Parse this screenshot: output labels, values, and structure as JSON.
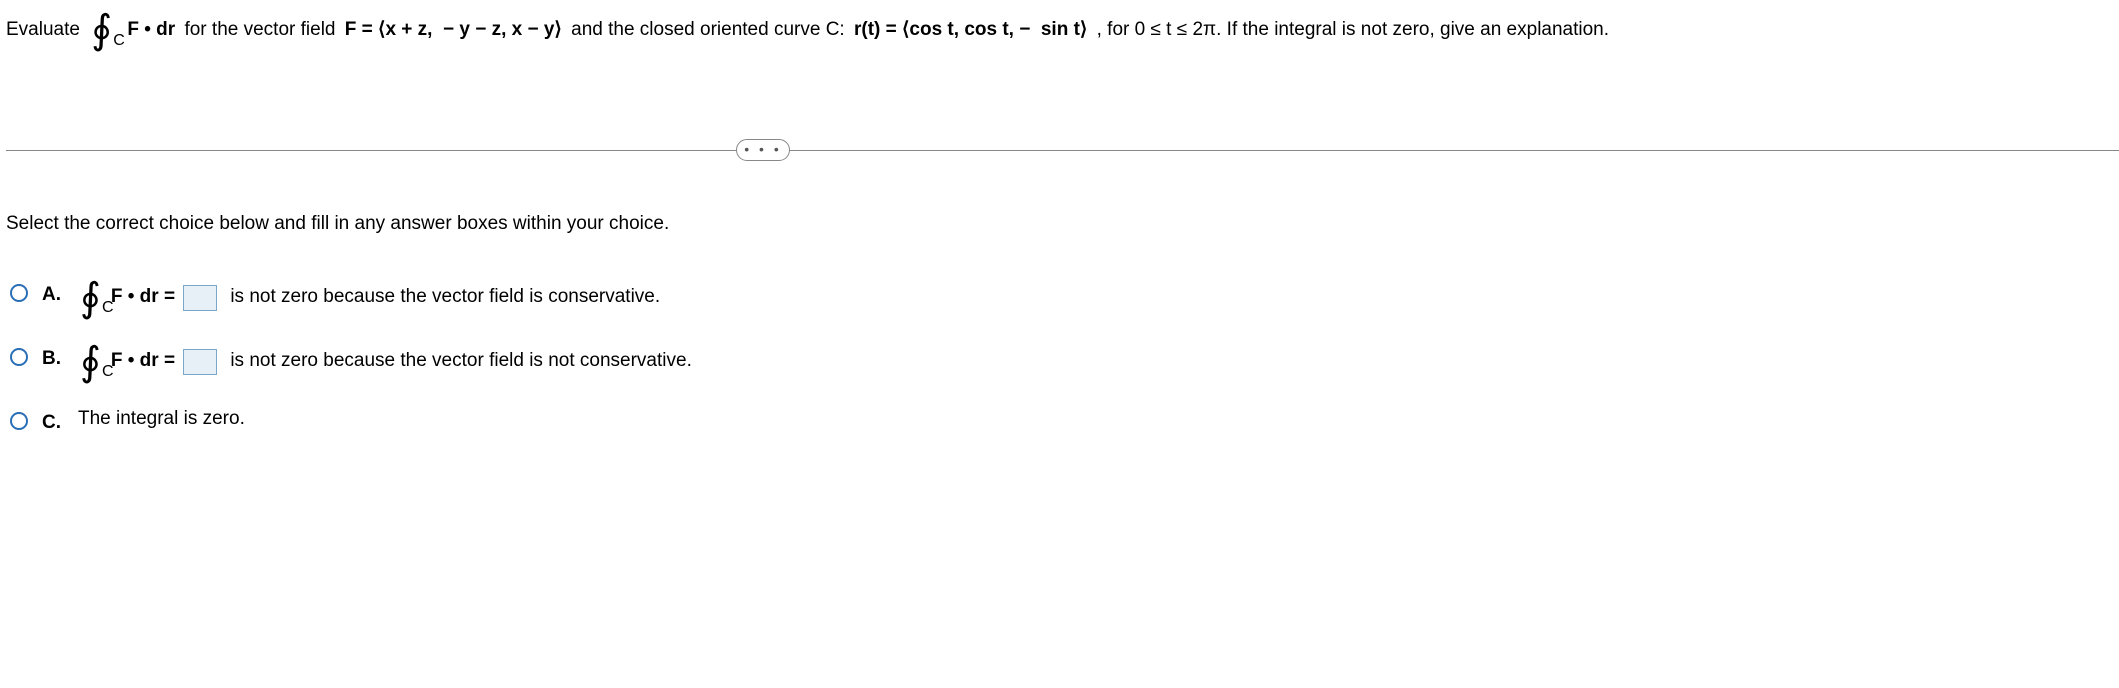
{
  "question": {
    "lead": "Evaluate ",
    "int_sub": "C",
    "after_int": " ",
    "fdr": "F • dr",
    "mid1": " for the vector field ",
    "field_eq": "F = ⟨x + z,  − y − z, x − y⟩",
    "mid2": " and the closed oriented curve C: ",
    "curve_eq": "r(t) = ⟨cos t, cos t, −  sin t⟩",
    "tail": " , for 0 ≤ t ≤ 2π. If the integral is not zero, give an explanation."
  },
  "dots": "• • •",
  "instruction": "Select the correct choice below and fill in any answer boxes within your choice.",
  "choices": {
    "a": {
      "label": "A.",
      "int_sub": "C",
      "fdr": "F • dr =",
      "text": " is not zero because the vector field is conservative."
    },
    "b": {
      "label": "B.",
      "int_sub": "C",
      "fdr": "F • dr =",
      "text": " is not zero because the vector field is not conservative."
    },
    "c": {
      "label": "C.",
      "text": "The integral is zero."
    }
  }
}
